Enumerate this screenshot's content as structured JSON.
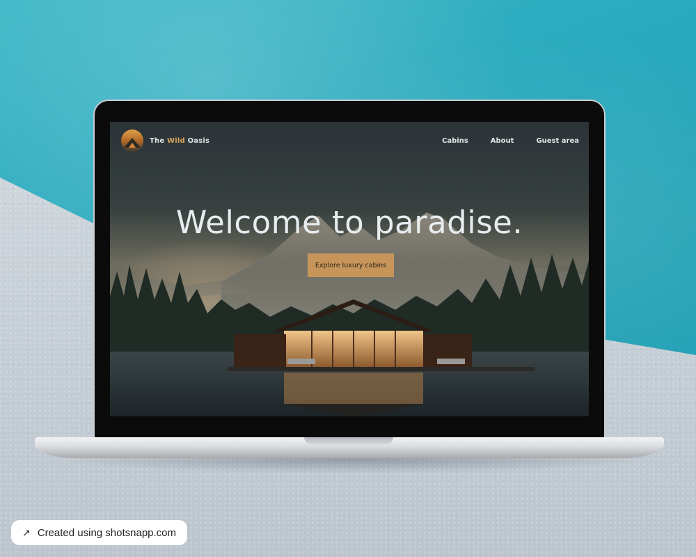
{
  "site": {
    "brand": {
      "prefix": "The",
      "accent": "Wild",
      "suffix": "Oasis"
    },
    "nav": [
      {
        "label": "Cabins"
      },
      {
        "label": "About"
      },
      {
        "label": "Guest area"
      }
    ],
    "hero": {
      "title": "Welcome to paradise.",
      "cta_label": "Explore luxury cabins"
    }
  },
  "watermark": {
    "icon": "arrow-up-right-icon",
    "text": "Created using shotsnapp.com"
  },
  "colors": {
    "accent": "#c7955a",
    "brand_accent_text": "#d7a35a",
    "background_water": "#2aa9bd",
    "floor": "#c9d1d8"
  }
}
